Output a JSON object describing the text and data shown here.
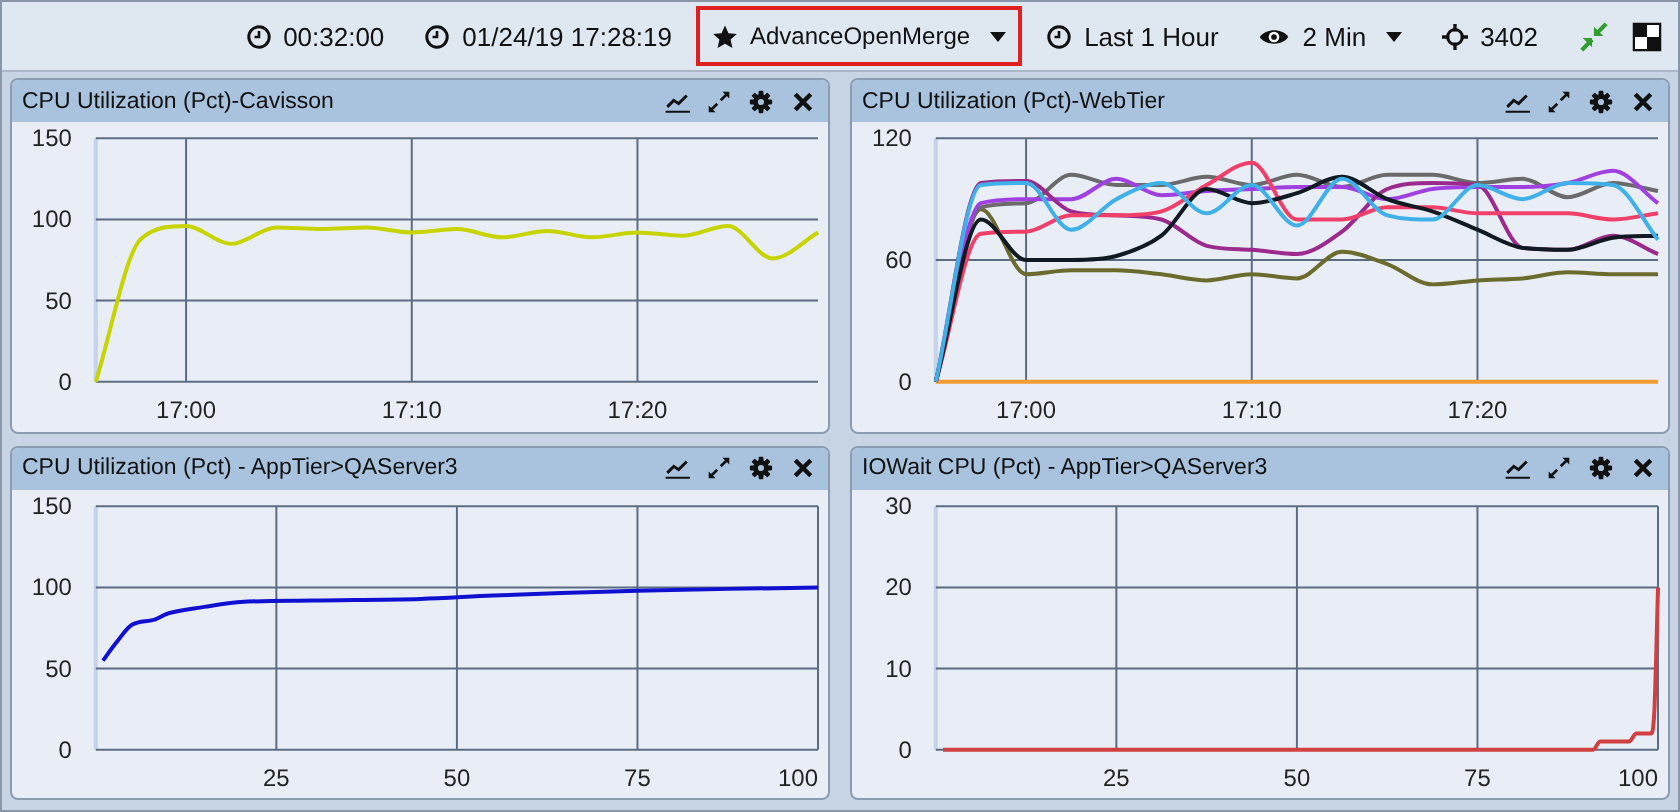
{
  "toolbar": {
    "items": [
      {
        "kind": "clock",
        "label": "00:32:00",
        "dropdown": false,
        "highlighted": false
      },
      {
        "kind": "clock",
        "label": "01/24/19 17:28:19",
        "dropdown": false,
        "highlighted": false
      },
      {
        "kind": "star",
        "label": "AdvanceOpenMerge",
        "dropdown": true,
        "highlighted": true
      },
      {
        "kind": "clock",
        "label": "Last 1 Hour",
        "dropdown": false,
        "highlighted": false
      },
      {
        "kind": "eye",
        "label": "2 Min",
        "dropdown": true,
        "highlighted": false
      },
      {
        "kind": "crosshair",
        "label": "3402",
        "dropdown": false,
        "highlighted": false
      }
    ]
  },
  "panels": [
    {
      "title": "CPU Utilization (Pct)-Cavisson",
      "chart_data": {
        "type": "line",
        "grid": true,
        "ylim": [
          0,
          150
        ],
        "yticks": [
          0,
          50,
          100,
          150
        ],
        "categories": [
          null,
          null,
          "17:00",
          null,
          null,
          null,
          null,
          "17:10",
          null,
          null,
          null,
          null,
          "17:20",
          null,
          null,
          null,
          null
        ],
        "series": [
          {
            "color": "#c8d400",
            "values": [
              0,
              88,
              96,
              85,
              95,
              94,
              95,
              92,
              94,
              89,
              93,
              89,
              92,
              90,
              96,
              76,
              92
            ]
          }
        ]
      }
    },
    {
      "title": "CPU Utilization (Pct)-WebTier",
      "chart_data": {
        "type": "line",
        "grid": true,
        "ylim": [
          0,
          120
        ],
        "yticks": [
          0,
          60,
          120
        ],
        "categories": [
          null,
          null,
          "17:00",
          null,
          null,
          null,
          null,
          "17:10",
          null,
          null,
          null,
          null,
          "17:20",
          null,
          null,
          null,
          null
        ],
        "series": [
          {
            "color": "#f39c34",
            "values": [
              0,
              0,
              0,
              0,
              0,
              0,
              0,
              0,
              0,
              0,
              0,
              0,
              0,
              0,
              0,
              0,
              0
            ]
          },
          {
            "color": "#6b6b2e",
            "values": [
              0,
              85,
              53,
              55,
              55,
              53,
              50,
              53,
              51,
              64,
              58,
              48,
              50,
              51,
              54,
              53,
              53
            ]
          },
          {
            "color": "#6a6a6a",
            "values": [
              0,
              86,
              88,
              102,
              97,
              97,
              101,
              97,
              102,
              96,
              102,
              102,
              98,
              100,
              91,
              98,
              94
            ]
          },
          {
            "color": "#a040e0",
            "values": [
              0,
              88,
              90,
              90,
              100,
              92,
              94,
              95,
              96,
              96,
              90,
              95,
              96,
              96,
              98,
              104,
              88
            ]
          },
          {
            "color": "#9b2a8c",
            "values": [
              0,
              98,
              99,
              84,
              82,
              80,
              67,
              65,
              63,
              74,
              95,
              98,
              97,
              66,
              65,
              72,
              63
            ]
          },
          {
            "color": "#f0406a",
            "values": [
              0,
              73,
              74,
              82,
              82,
              84,
              97,
              108,
              80,
              80,
              86,
              86,
              83,
              83,
              83,
              80,
              83
            ]
          },
          {
            "color": "#111a22",
            "values": [
              0,
              80,
              60,
              60,
              62,
              72,
              95,
              88,
              93,
              101,
              90,
              84,
              75,
              66,
              65,
              71,
              72
            ]
          },
          {
            "color": "#3fb0e8",
            "values": [
              0,
              97,
              98,
              75,
              90,
              98,
              83,
              97,
              77,
              100,
              82,
              80,
              97,
              90,
              98,
              97,
              70
            ]
          }
        ]
      }
    },
    {
      "title": "CPU Utilization (Pct) - AppTier>QAServer3",
      "chart_data": {
        "type": "line",
        "grid": true,
        "xlim": [
          0,
          100
        ],
        "ylim": [
          0,
          150
        ],
        "yticks": [
          0,
          50,
          100,
          150
        ],
        "xticks": [
          25,
          50,
          75,
          100
        ],
        "x": [
          1,
          3,
          5,
          8,
          10,
          15,
          20,
          30,
          45,
          55,
          75,
          100
        ],
        "series": [
          {
            "color": "#1010d0",
            "values": [
              55,
              67,
              77,
              80,
              84,
              88,
              91,
              92,
              93,
              95,
              98,
              100
            ]
          }
        ]
      }
    },
    {
      "title": "IOWait CPU (Pct) - AppTier>QAServer3",
      "chart_data": {
        "type": "line",
        "grid": true,
        "xlim": [
          0,
          100
        ],
        "ylim": [
          0,
          30
        ],
        "yticks": [
          0,
          10,
          20,
          30
        ],
        "xticks": [
          25,
          50,
          75,
          100
        ],
        "x": [
          1,
          91,
          92,
          96,
          97,
          99,
          99.5,
          100
        ],
        "series": [
          {
            "color": "#d04040",
            "values": [
              0,
              0,
              1,
              1,
              2,
              2,
              5,
              20
            ]
          }
        ]
      }
    }
  ]
}
